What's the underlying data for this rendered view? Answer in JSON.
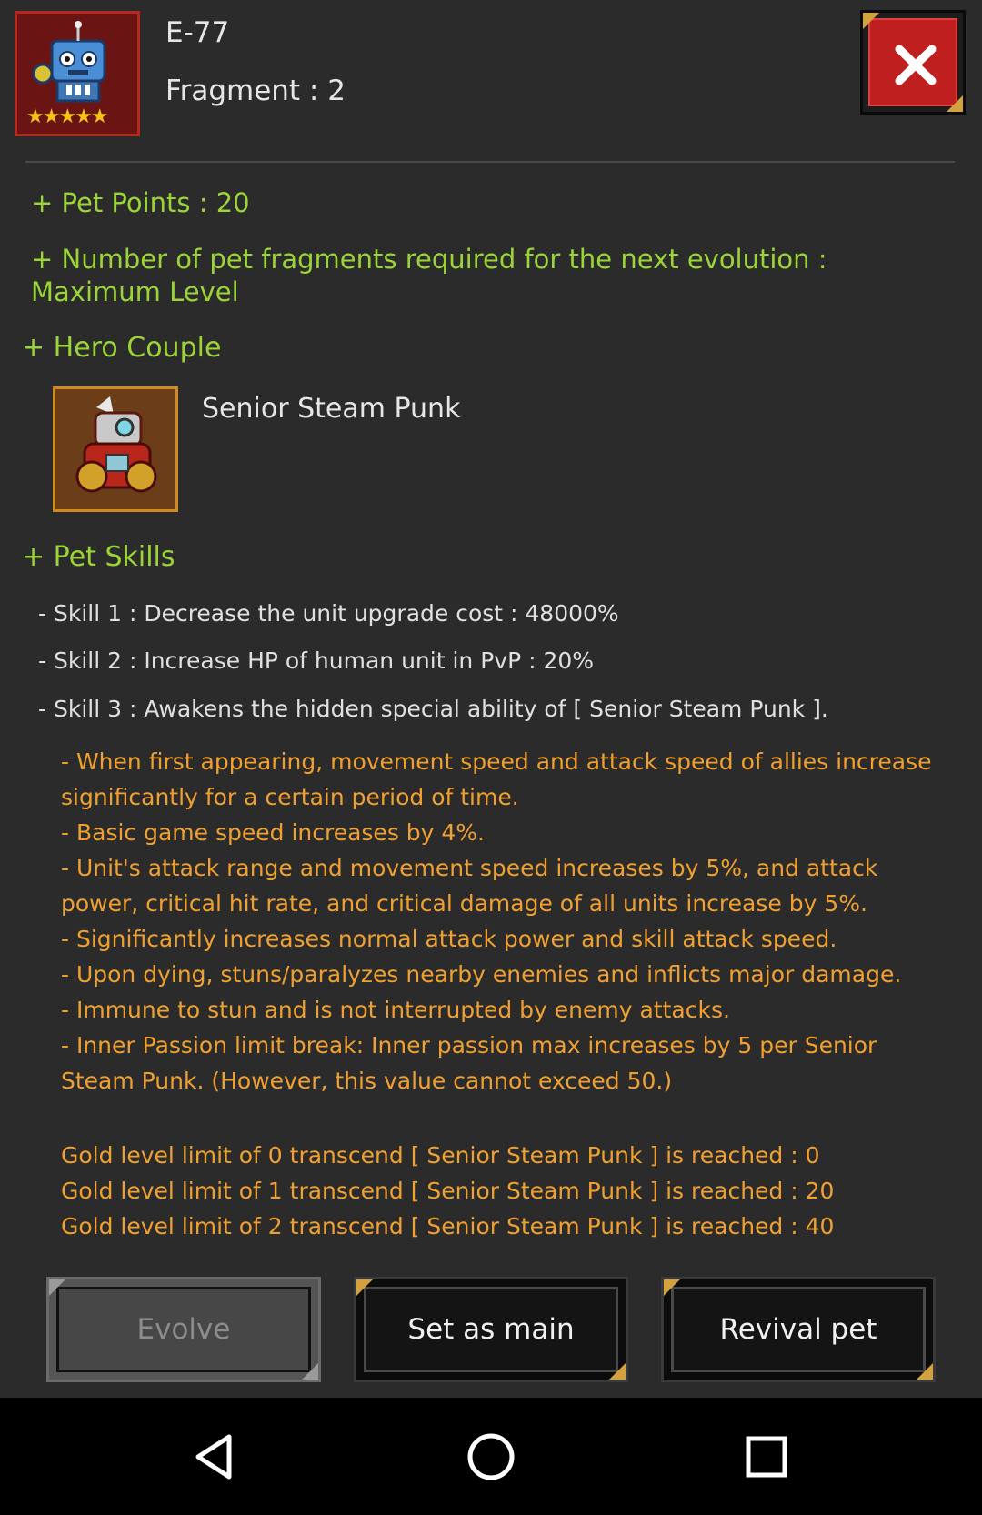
{
  "pet": {
    "name": "E-77",
    "fragment": "Fragment : 2",
    "stars": 5
  },
  "stats": {
    "pet_points": "+ Pet Points : 20",
    "fragments_required": "+ Number of pet fragments required for the next evolution :",
    "fragments_required_value": "Maximum Level"
  },
  "hero_couple": {
    "heading": "+ Hero Couple",
    "name": "Senior Steam Punk"
  },
  "skills": {
    "heading": "+ Pet Skills",
    "items": [
      "- Skill 1 : Decrease the unit upgrade cost : 48000%",
      "- Skill 2 : Increase HP of human unit in PvP : 20%",
      "- Skill 3 : Awakens the hidden special ability of [ Senior Steam Punk ]."
    ],
    "details": [
      "- When first appearing, movement speed and attack speed of allies increase",
      "significantly for a certain period of time.",
      "- Basic game speed increases by 4%.",
      "- Unit's attack range and movement speed increases by 5%, and attack",
      "power, critical hit rate, and critical damage of all units increase by 5%.",
      "- Significantly increases normal attack power and skill attack speed.",
      "- Upon dying, stuns/paralyzes nearby enemies and inflicts major damage.",
      "- Immune to stun and is not interrupted by enemy attacks.",
      "- Inner Passion limit break: Inner passion max increases by 5 per Senior",
      "Steam Punk. (However, this value cannot exceed 50.)"
    ],
    "gold_limits": [
      "Gold level limit of 0 transcend [ Senior Steam Punk ] is reached : 0",
      "Gold level limit of 1 transcend [ Senior Steam Punk ] is reached : 20",
      "Gold level limit of 2 transcend [ Senior Steam Punk ] is reached : 40"
    ]
  },
  "buttons": {
    "evolve": "Evolve",
    "set_main": "Set as main",
    "revival": "Revival pet"
  },
  "icons": {
    "close": "close-icon",
    "back": "back-icon",
    "home": "home-icon",
    "recents": "recents-icon"
  },
  "colors": {
    "accent_green": "#9bd437",
    "detail_orange": "#f0a030",
    "close_red": "#c01f1f",
    "gold_trim": "#d4a23c"
  }
}
